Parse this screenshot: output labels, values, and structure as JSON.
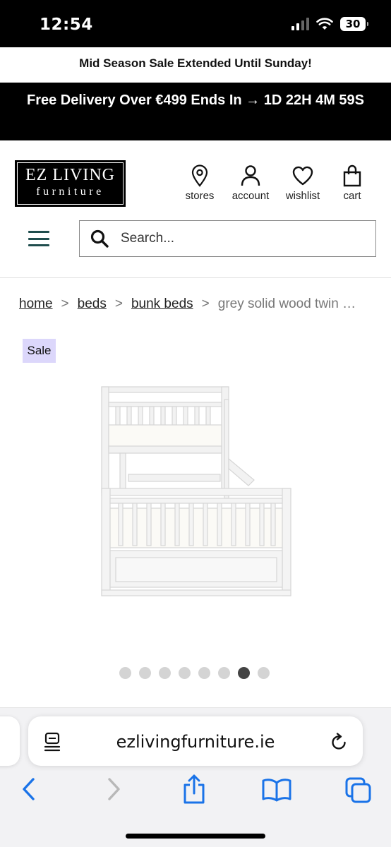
{
  "status_bar": {
    "time": "12:54",
    "battery": "30"
  },
  "promo": {
    "line1": "Mid Season Sale Extended Until Sunday!",
    "line2": "Free Delivery Over €499 Ends In → 1D 22H 4M 59S"
  },
  "header": {
    "logo_line1": "EZ LIVING",
    "logo_line2": "furniture",
    "stores_label": "stores",
    "account_label": "account",
    "wishlist_label": "wishlist",
    "cart_label": "cart",
    "search_placeholder": "Search..."
  },
  "breadcrumb": {
    "items": [
      "home",
      "beds",
      "bunk beds"
    ],
    "current": "grey solid wood twin …"
  },
  "product": {
    "badge": "Sale",
    "image_icon": "bunk-bed-image",
    "carousel": {
      "total": 8,
      "active_index": 7
    }
  },
  "browser": {
    "url": "ezlivingfurniture.ie"
  },
  "colors": {
    "accent_badge": "#dcd7fb",
    "ios_blue": "#1a73e8",
    "hamburger": "#1f4d4d"
  }
}
